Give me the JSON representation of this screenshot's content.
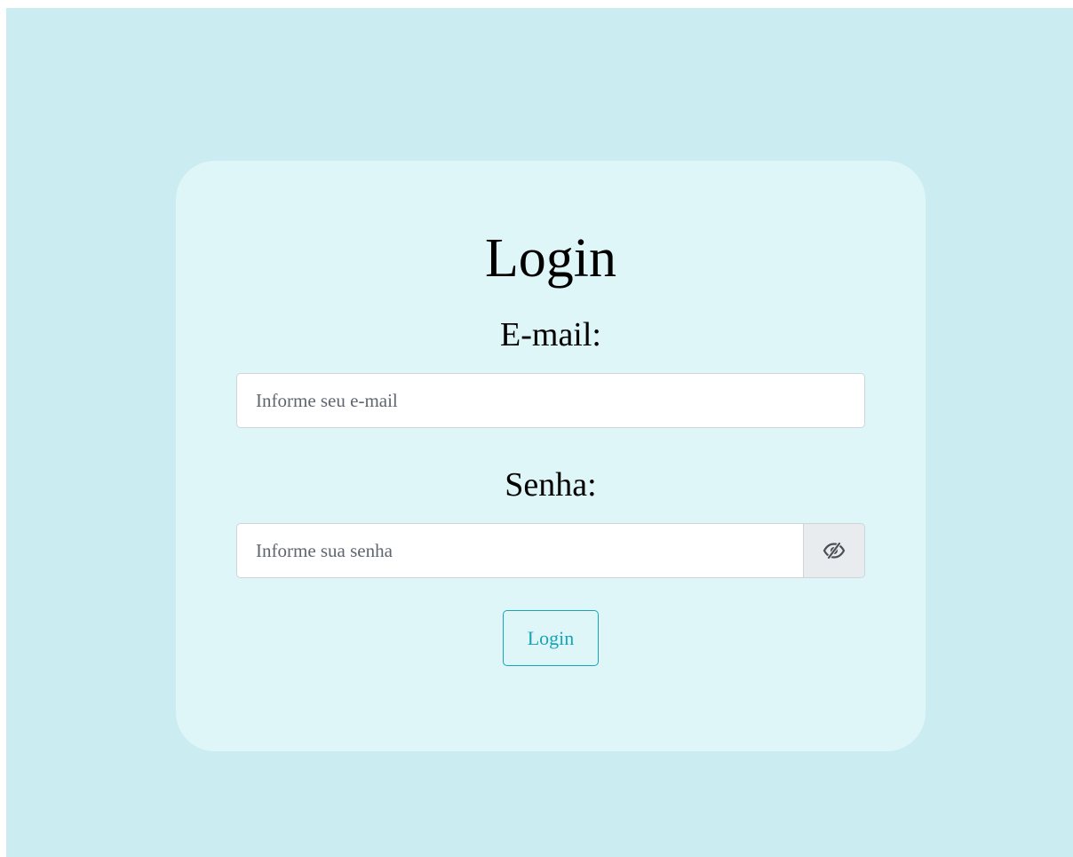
{
  "login_card": {
    "title": "Login",
    "email": {
      "label": "E-mail:",
      "placeholder": "Informe seu e-mail",
      "value": ""
    },
    "password": {
      "label": "Senha:",
      "placeholder": "Informe sua senha",
      "value": "",
      "toggle_icon": "eye-slash-icon"
    },
    "submit_label": "Login"
  },
  "colors": {
    "page_background": "#cbedf2",
    "card_background": "#dff6f9",
    "accent": "#17a2b8",
    "toggle_background": "#e9ecef"
  }
}
